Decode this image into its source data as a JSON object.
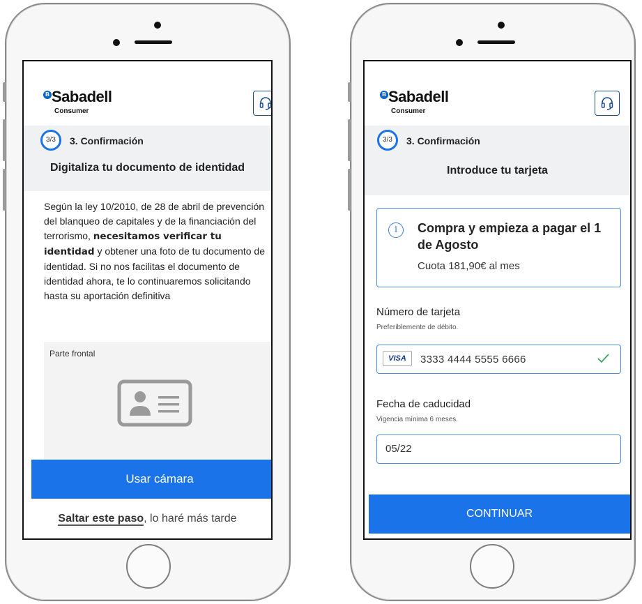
{
  "brand": {
    "badge": "B",
    "name": "Sabadell",
    "subtitle": "Consumer"
  },
  "colors": {
    "primary": "#1a73e8",
    "border": "#4a8fe0"
  },
  "left_screen": {
    "step_badge": "3/3",
    "step_title": "3. Confirmación",
    "heading": "Digitaliza tu documento de identidad",
    "legal": {
      "part1": "Según la ley 10/2010, de 28 de abril de prevención del blanqueo de capitales y de la financiación del terrorismo,",
      "bold": "necesitamos verificar tu identidad",
      "part2": "y obtener una foto de tu documento de identidad. Si no nos facilitas el documento de identidad ahora, te lo continuaremos solicitando hasta su aportación definitiva"
    },
    "front_label": "Parte frontal",
    "camera_button": "Usar cámara",
    "skip_link": "Saltar este paso",
    "skip_rest": ", lo haré más tarde"
  },
  "right_screen": {
    "step_badge": "3/3",
    "step_title": "3. Confirmación",
    "heading": "Introduce tu tarjeta",
    "info_title": "Compra y empieza a pagar el 1 de Agosto",
    "info_sub": "Cuota 181,90€ al mes",
    "card_label": "Número de tarjeta",
    "card_hint": "Preferiblemente de débito.",
    "card_brand": "VISA",
    "card_number": "3333 4444 5555 6666",
    "expiry_label": "Fecha de caducidad",
    "expiry_hint": "Vigencia mínima 6 meses.",
    "expiry_value": "05/22",
    "continue_button": "CONTINUAR"
  },
  "icons": {
    "help": "headset-icon",
    "info": "info-icon",
    "id": "id-card-icon",
    "check": "check-icon",
    "home": "home-button"
  }
}
